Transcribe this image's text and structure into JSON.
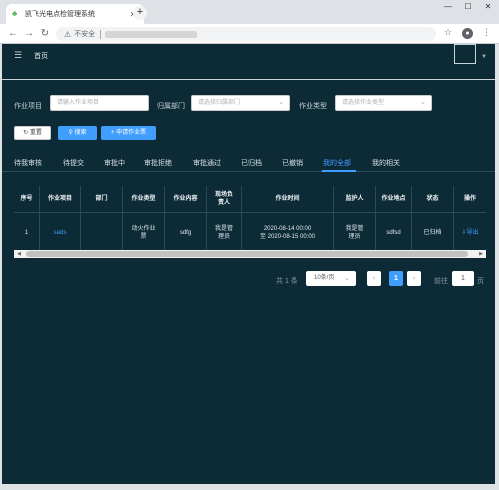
{
  "browser": {
    "tab_title": "凯飞光电点检管理系统",
    "unsafe_label": "不安全",
    "win_min": "—",
    "win_max": "☐",
    "win_close": "✕"
  },
  "header": {
    "home": "首页"
  },
  "filters": {
    "project_label": "作业项目",
    "project_placeholder": "请输入作业项目",
    "dept_label": "归属部门",
    "dept_placeholder": "请选择归属部门",
    "type_label": "作业类型",
    "type_placeholder": "请选择作业类型"
  },
  "buttons": {
    "reset": "重置",
    "search": "搜索",
    "apply": "申请作业票"
  },
  "tabs": [
    "待我审核",
    "待提交",
    "审批中",
    "审批拒绝",
    "审批通过",
    "已归档",
    "已撤销",
    "我的全部",
    "我的相关"
  ],
  "active_tab": "我的全部",
  "table": {
    "headers": [
      "序号",
      "作业项目",
      "部门",
      "作业类型",
      "作业内容",
      "现场负责人",
      "作业时间",
      "监护人",
      "作业地点",
      "状态",
      "操作"
    ],
    "rows": [
      {
        "index": "1",
        "project": "sads",
        "dept": "",
        "type": "动火作业票",
        "content": "sdfg",
        "leader": "我是管理员",
        "time_start": "2020-08-14 00:00",
        "time_end": "至 2020-08-15 00:00",
        "guardian": "我是管理员",
        "location": "sdfsd",
        "status": "已归档",
        "action": "导出"
      }
    ]
  },
  "pagination": {
    "total": "共 1 条",
    "page_size": "10条/页",
    "current_page": "1",
    "goto_label": "前往",
    "goto_value": "1",
    "page_suffix": "页"
  },
  "colors": {
    "background": "#0d2a37",
    "accent": "#409eff"
  }
}
